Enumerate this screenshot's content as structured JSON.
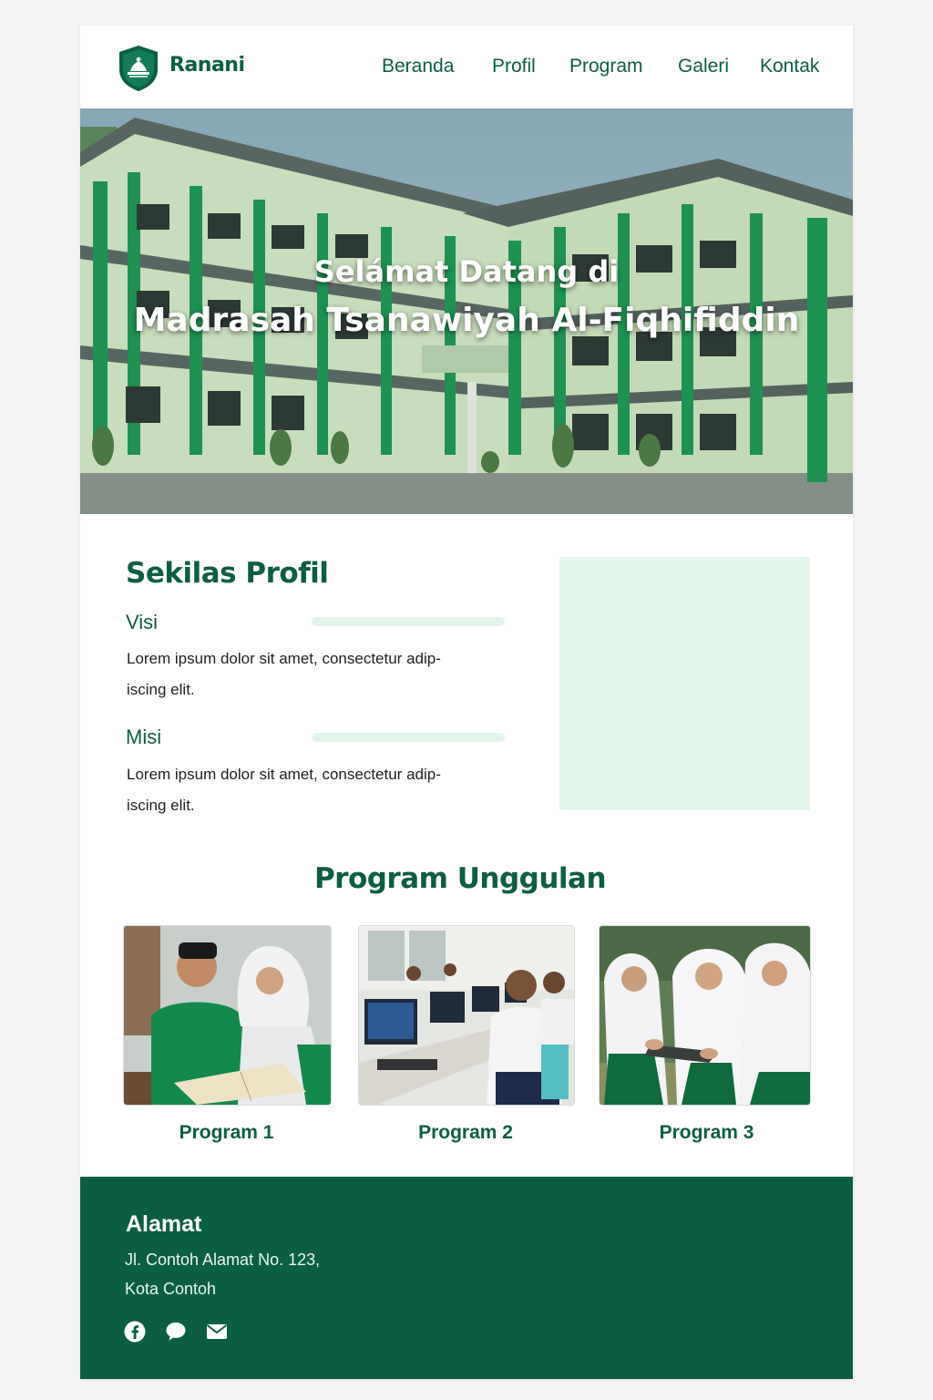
{
  "header": {
    "brand": "Ranani",
    "nav": [
      "Beranda",
      "Profil",
      "Program",
      "Galeri",
      "Kontak"
    ]
  },
  "hero": {
    "line1": "Selámat Datang di",
    "line2": "Madrasah Tsanawiyah Al-Fiqhifiddin"
  },
  "profile": {
    "title": "Sekilas Profil",
    "visi": {
      "label": "Visi",
      "line1": "Lorem ipsum dolor sit amet, consectetur adip-",
      "line2": "iscing elit."
    },
    "misi": {
      "label": "Misi",
      "line1": "Lorem ipsum dolor sit amet, consectetur adip-",
      "line2": "iscing elit."
    }
  },
  "programs": {
    "title": "Program Unggulan",
    "items": [
      "Program 1",
      "Program 2",
      "Program 3"
    ]
  },
  "footer": {
    "title": "Alamat",
    "line1": "Jl. Contoh Alamat No. 123,",
    "line2": "Kota Contoh",
    "social_icons": [
      "facebook-icon",
      "chat-icon",
      "mail-icon"
    ]
  },
  "colors": {
    "primary": "#0b5e43",
    "light_accent": "#e3f6ec",
    "building_green": "#1e9a55"
  }
}
